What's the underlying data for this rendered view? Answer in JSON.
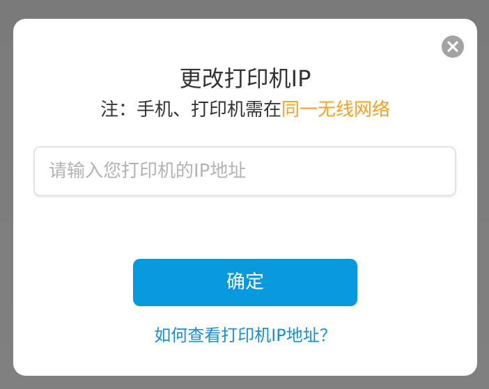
{
  "dialog": {
    "title": "更改打印机IP",
    "note_prefix": "注：手机、打印机需在",
    "note_highlight": "同一无线网络",
    "input_placeholder": "请输入您打印机的IP地址",
    "input_value": "",
    "confirm_label": "确定",
    "help_link": "如何查看打印机IP地址？",
    "close_icon": "close-icon"
  },
  "colors": {
    "backdrop": "#7f7f7f",
    "highlight": "#f3a023",
    "button": "#0898dc",
    "link": "#1590d6",
    "close": "#a3a3a3"
  }
}
